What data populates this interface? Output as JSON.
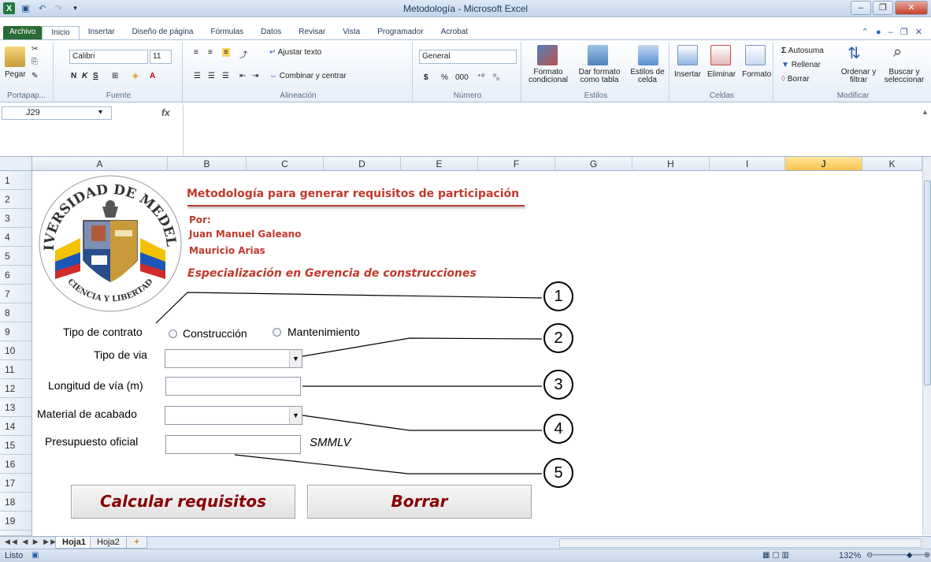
{
  "window": {
    "title": "Metodología - Microsoft Excel"
  },
  "ribbon_tabs": [
    "Archivo",
    "Inicio",
    "Insertar",
    "Diseño de página",
    "Fórmulas",
    "Datos",
    "Revisar",
    "Vista",
    "Programador",
    "Acrobat"
  ],
  "ribbon": {
    "paste_label": "Pegar",
    "clipboard_group": "Portapap...",
    "font_name": "Calibri",
    "font_size": "11",
    "font_group": "Fuente",
    "wrap_text": "Ajustar texto",
    "merge_center": "Combinar y centrar",
    "alignment_group": "Alineación",
    "number_format": "General",
    "number_group": "Número",
    "currency": "$",
    "percent": "%",
    "thousands": "000",
    "cond_format": "Formato condicional",
    "format_table": "Dar formato como tabla",
    "cell_styles": "Estilos de celda",
    "styles_group": "Estilos",
    "insert": "Insertar",
    "delete": "Eliminar",
    "format": "Formato",
    "cells_group": "Celdas",
    "autosum": "Autosuma",
    "fill": "Rellenar",
    "clear": "Borrar",
    "sort_filter": "Ordenar y filtrar",
    "find_select": "Buscar y seleccionar",
    "editing_group": "Modificar"
  },
  "formula_bar": {
    "name_box": "J29",
    "fx": "fx",
    "content": ""
  },
  "columns": [
    "A",
    "B",
    "C",
    "D",
    "E",
    "F",
    "G",
    "H",
    "I",
    "J",
    "K"
  ],
  "selected_column": "J",
  "rows": [
    "1",
    "2",
    "3",
    "4",
    "5",
    "6",
    "7",
    "8",
    "9",
    "10",
    "11",
    "12",
    "13",
    "14",
    "15",
    "16",
    "17",
    "18",
    "19"
  ],
  "sheet": {
    "logo_text_top": "UNIVERSIDAD DE MEDELLIN",
    "logo_text_bottom": "CIENCIA Y LIBERTAD",
    "title": "Metodología para generar requisitos de participación",
    "by_label": "Por:",
    "author1": "Juan Manuel Galeano",
    "author2": "Mauricio Arias",
    "program": "Especialización en Gerencia de construcciones"
  },
  "form": {
    "contract_type_label": "Tipo de contrato",
    "option_construction": "Construcción",
    "option_maintenance": "Mantenimiento",
    "road_type_label": "Tipo de via",
    "road_type_value": "",
    "road_length_label": "Longitud de vía (m)",
    "road_length_value": "",
    "finish_material_label": "Material de acabado",
    "finish_material_value": "",
    "budget_label": "Presupuesto oficial",
    "budget_value": "",
    "budget_units": "SMMLV",
    "calculate_button": "Calcular requisitos",
    "clear_button": "Borrar"
  },
  "callouts": [
    "1",
    "2",
    "3",
    "4",
    "5"
  ],
  "sheet_tabs": [
    "Hoja1",
    "Hoja2"
  ],
  "active_sheet": "Hoja1",
  "status": {
    "mode": "Listo",
    "zoom": "132%"
  }
}
